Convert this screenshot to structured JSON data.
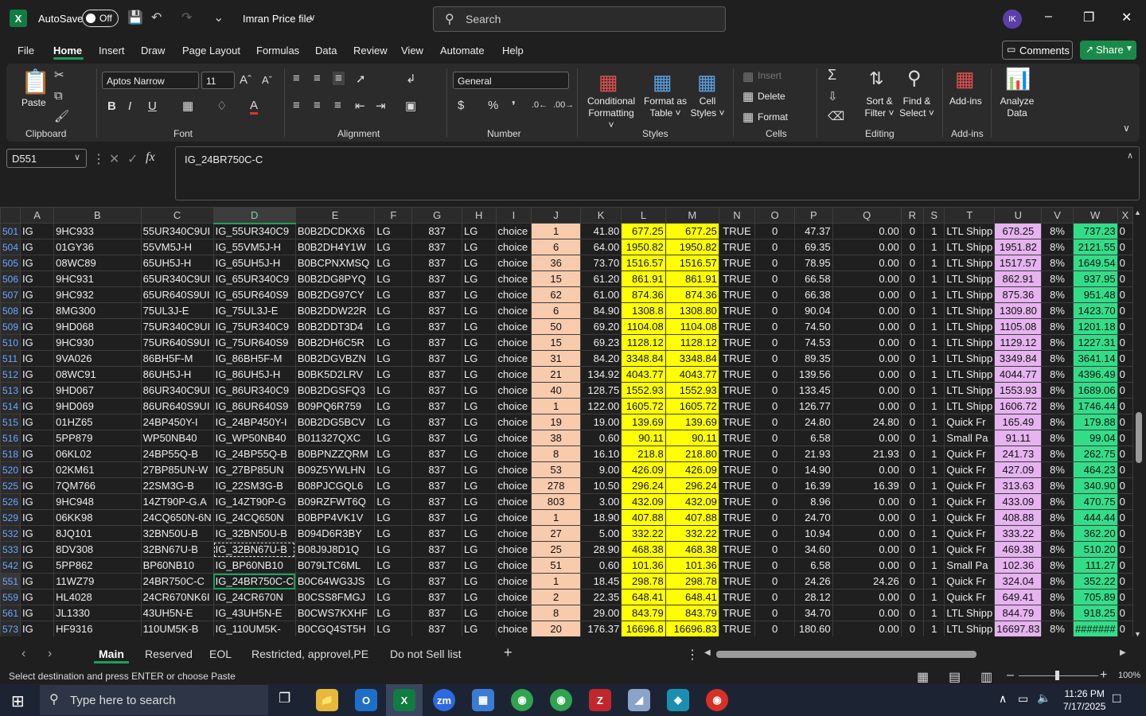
{
  "titlebar": {
    "autosave_label": "AutoSave",
    "toggle_state": "Off",
    "filename": "Imran Price file",
    "search_placeholder": "Search",
    "avatar_initials": "IK"
  },
  "menu": {
    "items": [
      "File",
      "Home",
      "Insert",
      "Draw",
      "Page Layout",
      "Formulas",
      "Data",
      "Review",
      "View",
      "Automate",
      "Help"
    ],
    "comments": "Comments",
    "share": "Share"
  },
  "ribbon": {
    "paste": "Paste",
    "clipboard": "Clipboard",
    "font_name": "Aptos Narrow",
    "font_size": "11",
    "font": "Font",
    "alignment": "Alignment",
    "number_format": "General",
    "number": "Number",
    "conditional": "Conditional",
    "formatting": "Formatting",
    "format_as": "Format as",
    "table": "Table",
    "cell": "Cell",
    "styles_btn": "Styles",
    "styles": "Styles",
    "insert": "Insert",
    "delete": "Delete",
    "format": "Format",
    "cells": "Cells",
    "sort": "Sort &",
    "filter": "Filter",
    "find": "Find &",
    "select": "Select",
    "editing": "Editing",
    "addins_btn": "Add-ins",
    "addins": "Add-ins",
    "analyze": "Analyze",
    "data": "Data"
  },
  "formula_bar": {
    "name_box": "D551",
    "formula": "IG_24BR750C-C"
  },
  "columns": [
    "A",
    "B",
    "C",
    "D",
    "E",
    "F",
    "G",
    "H",
    "I",
    "J",
    "K",
    "L",
    "M",
    "N",
    "O",
    "P",
    "Q",
    "R",
    "S",
    "T",
    "U",
    "V",
    "W",
    "X"
  ],
  "rows": [
    [
      "501",
      "IG",
      "9HC933",
      "55UR340C9UI",
      "IG_55UR340C9",
      "B0B2DCDKX6",
      "LG",
      "837",
      "LG",
      "choice",
      "1",
      "41.80",
      "677.25",
      "677.25",
      "TRUE",
      "0",
      "47.37",
      "0.00",
      "0",
      "1",
      "LTL Shipp",
      "678.25",
      "8%",
      "737.23",
      "0"
    ],
    [
      "504",
      "IG",
      "01GY36",
      "55VM5J-H",
      "IG_55VM5J-H",
      "B0B2DH4Y1W",
      "LG",
      "837",
      "LG",
      "choice",
      "6",
      "64.00",
      "1950.82",
      "1950.82",
      "TRUE",
      "0",
      "69.35",
      "0.00",
      "0",
      "1",
      "LTL Shipp",
      "1951.82",
      "8%",
      "2121.55",
      "0"
    ],
    [
      "505",
      "IG",
      "08WC89",
      "65UH5J-H",
      "IG_65UH5J-H",
      "B0BCPNXMSQ",
      "LG",
      "837",
      "LG",
      "choice",
      "36",
      "73.70",
      "1516.57",
      "1516.57",
      "TRUE",
      "0",
      "78.95",
      "0.00",
      "0",
      "1",
      "LTL Shipp",
      "1517.57",
      "8%",
      "1649.54",
      "0"
    ],
    [
      "506",
      "IG",
      "9HC931",
      "65UR340C9UI",
      "IG_65UR340C9",
      "B0B2DG8PYQ",
      "LG",
      "837",
      "LG",
      "choice",
      "15",
      "61.20",
      "861.91",
      "861.91",
      "TRUE",
      "0",
      "66.58",
      "0.00",
      "0",
      "1",
      "LTL Shipp",
      "862.91",
      "8%",
      "937.95",
      "0"
    ],
    [
      "507",
      "IG",
      "9HC932",
      "65UR640S9UI",
      "IG_65UR640S9",
      "B0B2DG97CY",
      "LG",
      "837",
      "LG",
      "choice",
      "62",
      "61.00",
      "874.36",
      "874.36",
      "TRUE",
      "0",
      "66.38",
      "0.00",
      "0",
      "1",
      "LTL Shipp",
      "875.36",
      "8%",
      "951.48",
      "0"
    ],
    [
      "508",
      "IG",
      "8MG300",
      "75UL3J-E",
      "IG_75UL3J-E",
      "B0B2DDW22R",
      "LG",
      "837",
      "LG",
      "choice",
      "6",
      "84.90",
      "1308.8",
      "1308.80",
      "TRUE",
      "0",
      "90.04",
      "0.00",
      "0",
      "1",
      "LTL Shipp",
      "1309.80",
      "8%",
      "1423.70",
      "0"
    ],
    [
      "509",
      "IG",
      "9HD068",
      "75UR340C9UI",
      "IG_75UR340C9",
      "B0B2DDT3D4",
      "LG",
      "837",
      "LG",
      "choice",
      "50",
      "69.20",
      "1104.08",
      "1104.08",
      "TRUE",
      "0",
      "74.50",
      "0.00",
      "0",
      "1",
      "LTL Shipp",
      "1105.08",
      "8%",
      "1201.18",
      "0"
    ],
    [
      "510",
      "IG",
      "9HC930",
      "75UR640S9UI",
      "IG_75UR640S9",
      "B0B2DH6C5R",
      "LG",
      "837",
      "LG",
      "choice",
      "15",
      "69.23",
      "1128.12",
      "1128.12",
      "TRUE",
      "0",
      "74.53",
      "0.00",
      "0",
      "1",
      "LTL Shipp",
      "1129.12",
      "8%",
      "1227.31",
      "0"
    ],
    [
      "511",
      "IG",
      "9VA026",
      "86BH5F-M",
      "IG_86BH5F-M",
      "B0B2DGVBZN",
      "LG",
      "837",
      "LG",
      "choice",
      "31",
      "84.20",
      "3348.84",
      "3348.84",
      "TRUE",
      "0",
      "89.35",
      "0.00",
      "0",
      "1",
      "LTL Shipp",
      "3349.84",
      "8%",
      "3641.14",
      "0"
    ],
    [
      "512",
      "IG",
      "08WC91",
      "86UH5J-H",
      "IG_86UH5J-H",
      "B0BK5D2LRV",
      "LG",
      "837",
      "LG",
      "choice",
      "21",
      "134.92",
      "4043.77",
      "4043.77",
      "TRUE",
      "0",
      "139.56",
      "0.00",
      "0",
      "1",
      "LTL Shipp",
      "4044.77",
      "8%",
      "4396.49",
      "0"
    ],
    [
      "513",
      "IG",
      "9HD067",
      "86UR340C9UI",
      "IG_86UR340C9",
      "B0B2DGSFQ3",
      "LG",
      "837",
      "LG",
      "choice",
      "40",
      "128.75",
      "1552.93",
      "1552.93",
      "TRUE",
      "0",
      "133.45",
      "0.00",
      "0",
      "1",
      "LTL Shipp",
      "1553.93",
      "8%",
      "1689.06",
      "0"
    ],
    [
      "514",
      "IG",
      "9HD069",
      "86UR640S9UI",
      "IG_86UR640S9",
      "B09PQ6R759",
      "LG",
      "837",
      "LG",
      "choice",
      "1",
      "122.00",
      "1605.72",
      "1605.72",
      "TRUE",
      "0",
      "126.77",
      "0.00",
      "0",
      "1",
      "LTL Shipp",
      "1606.72",
      "8%",
      "1746.44",
      "0"
    ],
    [
      "515",
      "IG",
      "01HZ65",
      "24BP450Y-I",
      "IG_24BP450Y-I",
      "B0B2DG5BCV",
      "LG",
      "837",
      "LG",
      "choice",
      "19",
      "19.00",
      "139.69",
      "139.69",
      "TRUE",
      "0",
      "24.80",
      "24.80",
      "0",
      "1",
      "Quick Fr",
      "165.49",
      "8%",
      "179.88",
      "0"
    ],
    [
      "516",
      "IG",
      "5PP879",
      "WP50NB40",
      "IG_WP50NB40",
      "B011327QXC",
      "LG",
      "837",
      "LG",
      "choice",
      "38",
      "0.60",
      "90.11",
      "90.11",
      "TRUE",
      "0",
      "6.58",
      "0.00",
      "0",
      "1",
      "Small Pa",
      "91.11",
      "8%",
      "99.04",
      "0"
    ],
    [
      "518",
      "IG",
      "06KL02",
      "24BP55Q-B",
      "IG_24BP55Q-B",
      "B0BPNZZQRM",
      "LG",
      "837",
      "LG",
      "choice",
      "8",
      "16.10",
      "218.8",
      "218.80",
      "TRUE",
      "0",
      "21.93",
      "21.93",
      "0",
      "1",
      "Quick Fr",
      "241.73",
      "8%",
      "262.75",
      "0"
    ],
    [
      "520",
      "IG",
      "02KM61",
      "27BP85UN-W",
      "IG_27BP85UN",
      "B09Z5YWLHN",
      "LG",
      "837",
      "LG",
      "choice",
      "53",
      "9.00",
      "426.09",
      "426.09",
      "TRUE",
      "0",
      "14.90",
      "0.00",
      "0",
      "1",
      "Quick Fr",
      "427.09",
      "8%",
      "464.23",
      "0"
    ],
    [
      "525",
      "IG",
      "7QM766",
      "22SM3G-B",
      "IG_22SM3G-B",
      "B08PJCGQL6",
      "LG",
      "837",
      "LG",
      "choice",
      "278",
      "10.50",
      "296.24",
      "296.24",
      "TRUE",
      "0",
      "16.39",
      "16.39",
      "0",
      "1",
      "Quick Fr",
      "313.63",
      "8%",
      "340.90",
      "0"
    ],
    [
      "526",
      "IG",
      "9HC948",
      "14ZT90P-G.A",
      "IG_14ZT90P-G",
      "B09RZFWT6Q",
      "LG",
      "837",
      "LG",
      "choice",
      "803",
      "3.00",
      "432.09",
      "432.09",
      "TRUE",
      "0",
      "8.96",
      "0.00",
      "0",
      "1",
      "Quick Fr",
      "433.09",
      "8%",
      "470.75",
      "0"
    ],
    [
      "529",
      "IG",
      "06KK98",
      "24CQ650N-6N",
      "IG_24CQ650N",
      "B0BPP4VK1V",
      "LG",
      "837",
      "LG",
      "choice",
      "1",
      "18.90",
      "407.88",
      "407.88",
      "TRUE",
      "0",
      "24.70",
      "0.00",
      "0",
      "1",
      "Quick Fr",
      "408.88",
      "8%",
      "444.44",
      "0"
    ],
    [
      "532",
      "IG",
      "8JQ101",
      "32BN50U-B",
      "IG_32BN50U-B",
      "B094D6R3BY",
      "LG",
      "837",
      "LG",
      "choice",
      "27",
      "5.00",
      "332.22",
      "332.22",
      "TRUE",
      "0",
      "10.94",
      "0.00",
      "0",
      "1",
      "Quick Fr",
      "333.22",
      "8%",
      "362.20",
      "0"
    ],
    [
      "533",
      "IG",
      "8DV308",
      "32BN67U-B",
      "IG_32BN67U-B",
      "B08J9J8D1Q",
      "LG",
      "837",
      "LG",
      "choice",
      "25",
      "28.90",
      "468.38",
      "468.38",
      "TRUE",
      "0",
      "34.60",
      "0.00",
      "0",
      "1",
      "Quick Fr",
      "469.38",
      "8%",
      "510.20",
      "0"
    ],
    [
      "542",
      "IG",
      "5PP862",
      "BP60NB10",
      "IG_BP60NB10",
      "B079LTC6ML",
      "LG",
      "837",
      "LG",
      "choice",
      "51",
      "0.60",
      "101.36",
      "101.36",
      "TRUE",
      "0",
      "6.58",
      "0.00",
      "0",
      "1",
      "Small Pa",
      "102.36",
      "8%",
      "111.27",
      "0"
    ],
    [
      "551",
      "IG",
      "11WZ79",
      "24BR750C-C",
      "IG_24BR750C-C",
      "B0C64WG3JS",
      "LG",
      "837",
      "LG",
      "choice",
      "1",
      "18.45",
      "298.78",
      "298.78",
      "TRUE",
      "0",
      "24.26",
      "24.26",
      "0",
      "1",
      "Quick Fr",
      "324.04",
      "8%",
      "352.22",
      "0"
    ],
    [
      "559",
      "IG",
      "HL4028",
      "24CR670NK6I",
      "IG_24CR670N",
      "B0CSS8FMGJ",
      "LG",
      "837",
      "LG",
      "choice",
      "2",
      "22.35",
      "648.41",
      "648.41",
      "TRUE",
      "0",
      "28.12",
      "0.00",
      "0",
      "1",
      "Quick Fr",
      "649.41",
      "8%",
      "705.89",
      "0"
    ],
    [
      "561",
      "IG",
      "JL1330",
      "43UH5N-E",
      "IG_43UH5N-E",
      "B0CWS7KXHF",
      "LG",
      "837",
      "LG",
      "choice",
      "8",
      "29.00",
      "843.79",
      "843.79",
      "TRUE",
      "0",
      "34.70",
      "0.00",
      "0",
      "1",
      "LTL Shipp",
      "844.79",
      "8%",
      "918.25",
      "0"
    ],
    [
      "573",
      "IG",
      "HF9316",
      "110UM5K-B",
      "IG_110UM5K-",
      "B0CGQ4ST5H",
      "LG",
      "837",
      "LG",
      "choice",
      "20",
      "176.37",
      "16696.8",
      "16696.83",
      "TRUE",
      "0",
      "180.60",
      "0.00",
      "0",
      "1",
      "LTL Shipp",
      "16697.83",
      "8%",
      "#######",
      "0"
    ]
  ],
  "sheet_tabs": [
    "Main",
    "Reserved",
    "EOL",
    "Restricted, approvel,PE",
    "Do not Sell list"
  ],
  "status": {
    "message": "Select destination and press ENTER or choose Paste",
    "zoom": "100%"
  },
  "taskbar": {
    "search_placeholder": "Type here to search",
    "time": "11:26 PM",
    "date": "7/17/2025"
  }
}
